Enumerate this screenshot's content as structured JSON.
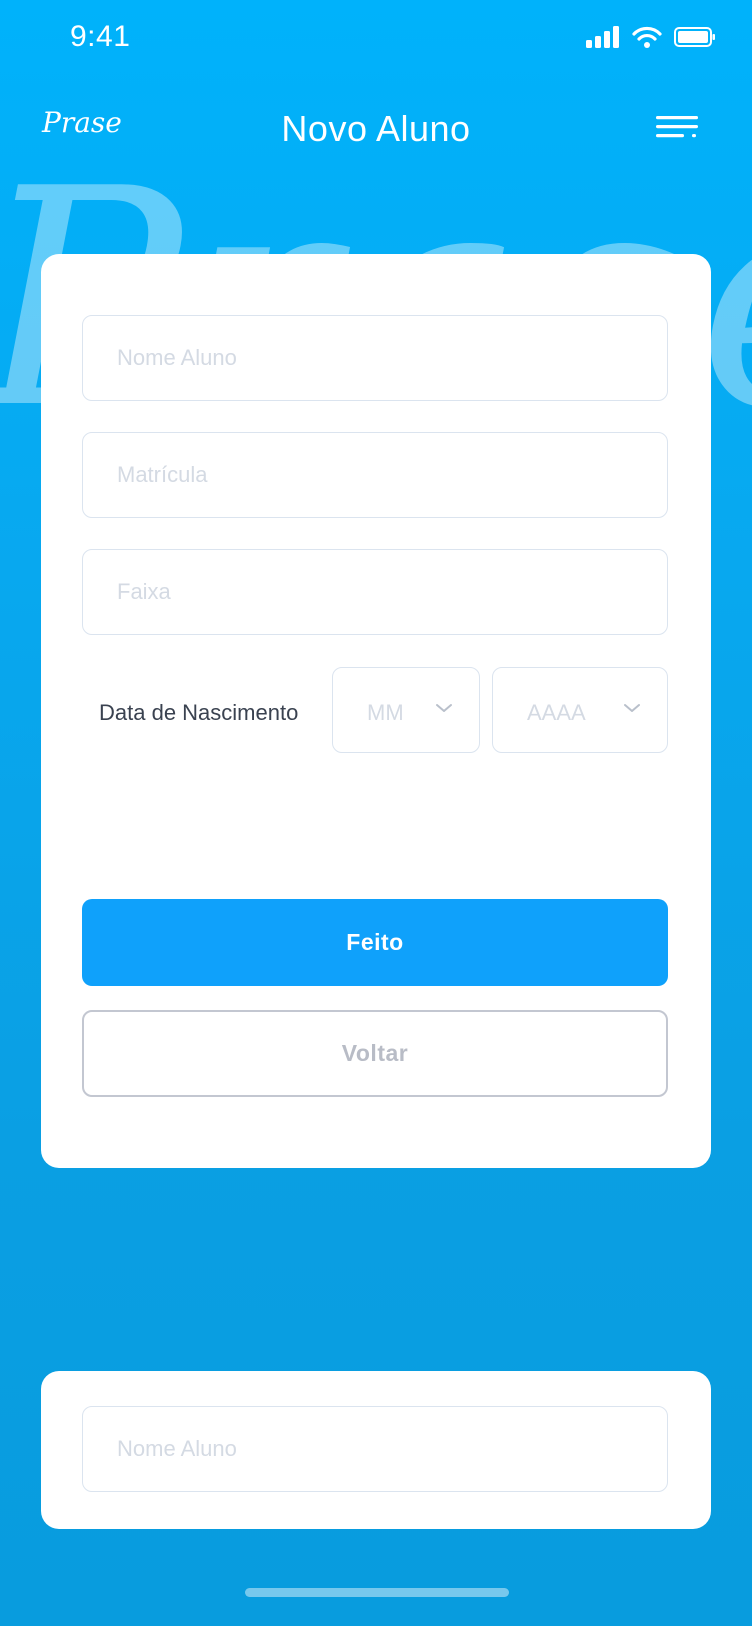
{
  "status_bar": {
    "time": "9:41"
  },
  "header": {
    "logo": "Prase",
    "title": "Novo Aluno",
    "menu_icon": "menu-lines-icon"
  },
  "background": {
    "watermark_text": "Prase"
  },
  "form": {
    "nome_placeholder": "Nome Aluno",
    "matricula_placeholder": "Matrícula",
    "faixa_placeholder": "Faixa",
    "birth_date_label": "Data de Nascimento",
    "month_placeholder": "MM",
    "year_placeholder": "AAAA",
    "submit_label": "Feito",
    "back_label": "Voltar"
  },
  "secondary_card": {
    "nome_placeholder": "Nome Aluno"
  },
  "colors": {
    "background_top": "#00b2fb",
    "background_bottom": "#089cde",
    "primary_button": "#0fa1fb",
    "card": "#ffffff",
    "field_border": "#dbe4ef",
    "placeholder_text": "#d4dae3",
    "label_text": "#3a4250",
    "secondary_button_border": "#c3c7d1"
  }
}
